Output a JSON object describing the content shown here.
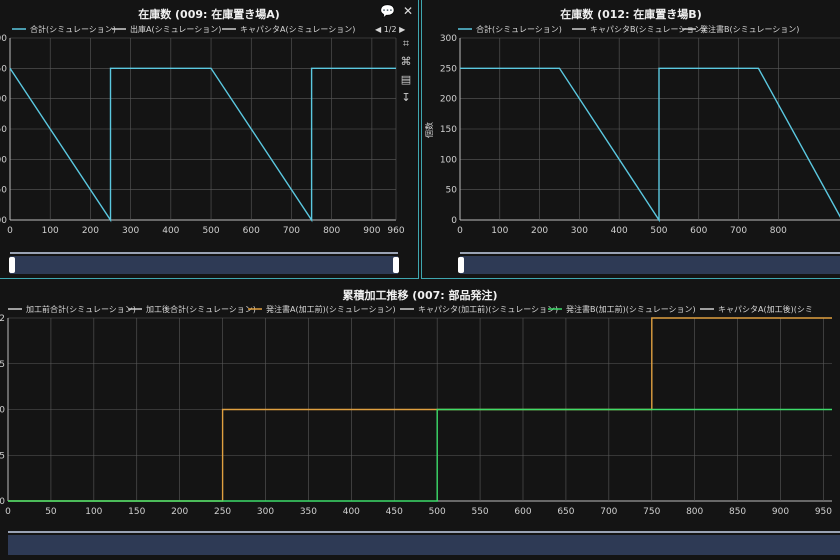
{
  "panels": [
    {
      "title": "在庫数 (009: 在庫置き場A)",
      "pager": "1/2",
      "legend": [
        "合計(シミュレーション)",
        "出庫A(シミュレーション)",
        "キャパシタA(シミュレーション)"
      ]
    },
    {
      "title": "在庫数 (012: 在庫置き場B)",
      "ylabel": "個数",
      "legend": [
        "合計(シミュレーション)",
        "キャパシタB(シミュレーション)",
        "発注書B(シミュレーション)"
      ]
    },
    {
      "title": "累積加工推移 (007: 部品発注)",
      "legend": [
        "加工前合計(シミュレーション)",
        "加工後合計(シミュレーション)",
        "発注書A(加工前)(シミュレーション)",
        "キャパシタ(加工前)(シミュレーション)",
        "発注書B(加工前)(シミュレーション)",
        "キャパシタA(加工後)(シミ"
      ]
    }
  ],
  "chart_data": [
    {
      "type": "line",
      "title": "在庫数 (009: 在庫置き場A)",
      "xlim": [
        0,
        960
      ],
      "ylim": [
        0,
        300
      ],
      "xticks": [
        0,
        100,
        200,
        300,
        400,
        500,
        600,
        700,
        800,
        900,
        960
      ],
      "yticks": [
        0,
        50,
        100,
        150,
        200,
        250,
        300
      ],
      "yticklabels_visible": [
        "00",
        "50",
        "00",
        "50",
        "00",
        "50",
        "00"
      ],
      "grid": true,
      "legend_position": "top",
      "series": [
        {
          "name": "合計(シミュレーション)",
          "color": "#5bc8e0",
          "points": [
            [
              0,
              250
            ],
            [
              250,
              0
            ],
            [
              250,
              250
            ],
            [
              500,
              250
            ],
            [
              750,
              0
            ],
            [
              750,
              250
            ],
            [
              960,
              250
            ]
          ]
        }
      ]
    },
    {
      "type": "line",
      "title": "在庫数 (012: 在庫置き場B)",
      "ylabel": "個数",
      "xlim": [
        0,
        960
      ],
      "ylim": [
        0,
        300
      ],
      "xticks": [
        0,
        100,
        200,
        300,
        400,
        500,
        600,
        700,
        800
      ],
      "yticks": [
        0,
        50,
        100,
        150,
        200,
        250,
        300
      ],
      "grid": true,
      "legend_position": "top",
      "series": [
        {
          "name": "合計(シミュレーション)",
          "color": "#5bc8e0",
          "points": [
            [
              0,
              250
            ],
            [
              250,
              250
            ],
            [
              500,
              0
            ],
            [
              500,
              250
            ],
            [
              750,
              250
            ],
            [
              960,
              0
            ]
          ]
        }
      ]
    },
    {
      "type": "line",
      "title": "累積加工推移 (007: 部品発注)",
      "xlim": [
        0,
        960
      ],
      "ylim": [
        0,
        2
      ],
      "xticks": [
        0,
        50,
        100,
        150,
        200,
        250,
        300,
        350,
        400,
        450,
        500,
        550,
        600,
        650,
        700,
        750,
        800,
        850,
        900,
        950
      ],
      "yticks": [
        0,
        0.5,
        1,
        1.5,
        2
      ],
      "yticklabels_visible": [
        "0",
        "5",
        "0",
        "5",
        "2"
      ],
      "grid": true,
      "legend_position": "top",
      "series": [
        {
          "name": "発注書A(加工前)(シミュレーション)",
          "color": "#e0a040",
          "points": [
            [
              0,
              0
            ],
            [
              250,
              0
            ],
            [
              250,
              1
            ],
            [
              750,
              1
            ],
            [
              750,
              2
            ],
            [
              960,
              2
            ]
          ]
        },
        {
          "name": "発注書B(加工前)(シミュレーション)",
          "color": "#3ddc6a",
          "points": [
            [
              0,
              0
            ],
            [
              500,
              0
            ],
            [
              500,
              1
            ],
            [
              960,
              1
            ]
          ]
        }
      ]
    }
  ],
  "colors": {
    "grid": "#5a5a5a",
    "axis": "#bdbdbd",
    "accent": "#3fa7b0",
    "scroll": "#2e3a55"
  }
}
